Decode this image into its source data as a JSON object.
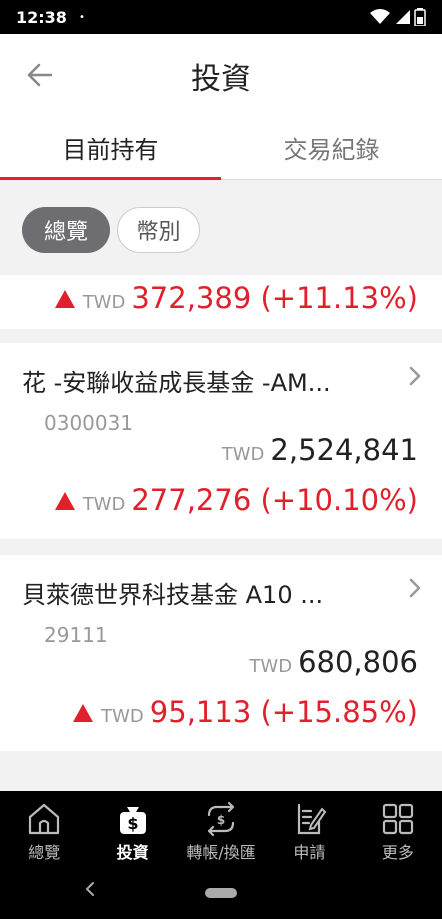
{
  "status_bar": {
    "time": "12:38",
    "dot": "•"
  },
  "header": {
    "title": "投資"
  },
  "tabs": [
    {
      "label": "目前持有",
      "active": true
    },
    {
      "label": "交易紀錄",
      "active": false
    }
  ],
  "filters": [
    {
      "label": "總覽",
      "active": true
    },
    {
      "label": "幣別",
      "active": false
    }
  ],
  "holdings_partial": {
    "currency": "TWD",
    "profit_loss": "372,389 (+11.13%)",
    "direction": "up"
  },
  "holdings": [
    {
      "name": "花  -安聯收益成長基金  -AM...",
      "code": "0300031",
      "currency": "TWD",
      "market_value": "2,524,841",
      "profit_loss": "277,276 (+10.10%)",
      "direction": "up"
    },
    {
      "name": "貝萊德世界科技基金 A10 ...",
      "code": "29111",
      "currency": "TWD",
      "market_value": "680,806",
      "profit_loss": "95,113 (+15.85%)",
      "direction": "up"
    }
  ],
  "bottom_nav": [
    {
      "label": "總覽",
      "icon": "home-icon",
      "active": false
    },
    {
      "label": "投資",
      "icon": "money-bag-icon",
      "active": true
    },
    {
      "label": "轉帳/換匯",
      "icon": "transfer-icon",
      "active": false
    },
    {
      "label": "申請",
      "icon": "apply-icon",
      "active": false
    },
    {
      "label": "更多",
      "icon": "grid-icon",
      "active": false
    }
  ],
  "colors": {
    "accent": "#e0212c",
    "up": "#e0212c",
    "nav_bg": "#000000",
    "chip_active": "#6d6d72"
  }
}
